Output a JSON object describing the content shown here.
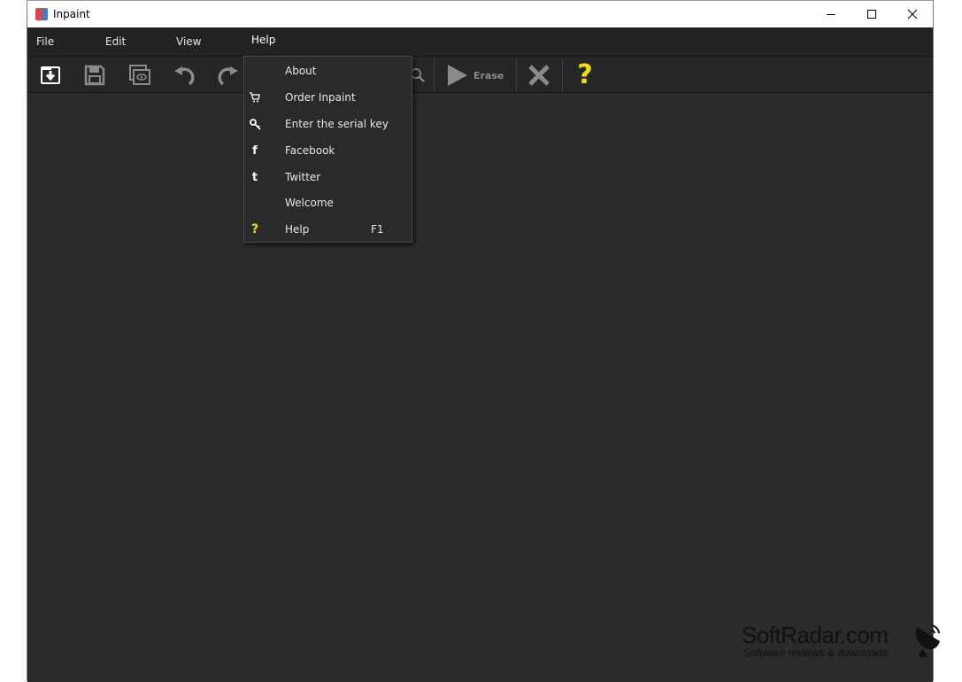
{
  "window": {
    "title": "Inpaint"
  },
  "menubar": {
    "items": [
      "File",
      "Edit",
      "View",
      "Help"
    ]
  },
  "toolbar": {
    "erase_label": "Erase"
  },
  "help_menu": {
    "items": [
      {
        "label": "About",
        "icon": "none",
        "shortcut": ""
      },
      {
        "label": "Order Inpaint",
        "icon": "cart-icon",
        "shortcut": ""
      },
      {
        "label": "Enter the serial key",
        "icon": "key-icon",
        "shortcut": ""
      },
      {
        "label": "Facebook",
        "icon": "facebook-icon",
        "shortcut": ""
      },
      {
        "label": "Twitter",
        "icon": "twitter-icon",
        "shortcut": ""
      },
      {
        "label": "Welcome",
        "icon": "none",
        "shortcut": ""
      },
      {
        "label": "Help",
        "icon": "question-icon",
        "shortcut": "F1"
      }
    ]
  },
  "watermark": {
    "brand": "SoftRadar.com",
    "tagline": "Software reviews & downloads"
  },
  "colors": {
    "help_accent": "#f5e100",
    "window_bg": "#2b2b2b",
    "menu_bg": "#222222"
  }
}
